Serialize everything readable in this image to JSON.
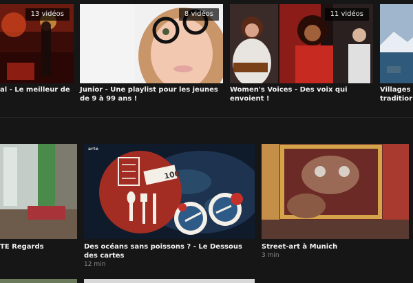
{
  "playlists": [
    {
      "title": "al - Le meilleur de la",
      "badge": "13 vidéos"
    },
    {
      "title": "Junior - Une playlist pour les jeunes de 9 à 99 ans !",
      "badge": "8 vidéos"
    },
    {
      "title": "Women's Voices - Des voix qui envoient !",
      "badge": "11 vidéos"
    },
    {
      "title": "Villages traditior"
    }
  ],
  "videos": [
    {
      "title": "TE Regards"
    },
    {
      "title": "Des océans sans poissons ? - Le Dessous des cartes",
      "duration": "12 min",
      "brand": "arte",
      "thumb_number": "100"
    },
    {
      "title": "Street-art à Munich",
      "duration": "3 min"
    }
  ]
}
